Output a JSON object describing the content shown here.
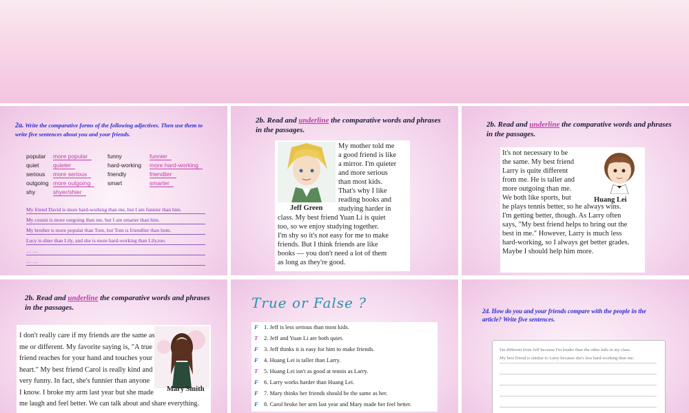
{
  "slide1": {
    "num": "2a.",
    "instruction": "Write the comparative forms of the following adjectives. Then use them to write five sentences about you and your friends.",
    "left_pairs": [
      {
        "adj": "popular",
        "ans": "more popular"
      },
      {
        "adj": "quiet",
        "ans": "quieter"
      },
      {
        "adj": "serious",
        "ans": "more serious"
      },
      {
        "adj": "outgoing",
        "ans": "more outgoing"
      },
      {
        "adj": "shy",
        "ans": "shyer/shier"
      }
    ],
    "right_pairs": [
      {
        "adj": "funny",
        "ans": "funnier"
      },
      {
        "adj": "hard-working",
        "ans": "more hard-working"
      },
      {
        "adj": "friendly",
        "ans": "friendlier"
      },
      {
        "adj": "smart",
        "ans": "smarter"
      }
    ],
    "sentences": [
      "My friend David is more hard-working than me, but I am funnier than him.",
      "My cousin is more outgoing than me, but I am smarter than him.",
      "My brother is more popular than Tom, but Tom is friendlier than hom.",
      "Lucy is shier than Lily, and she is more hard-working than Lily,too.",
      "… …",
      "… …"
    ]
  },
  "heading26": {
    "num": "2b.",
    "pre": "Read and",
    "ul": "underline",
    "post": "the comparative words and phrases",
    "line2": "in the passages."
  },
  "jeff": {
    "name": "Jeff Green",
    "right_lines": [
      "My mother told me",
      "a good friend is like",
      "a mirror. I'm quieter",
      "and more serious",
      "than most kids.",
      "That's why I like",
      "reading books and",
      "studying harder in"
    ],
    "lines": [
      "class. My best friend Yuan Li is quiet",
      "too, so we enjoy studying together.",
      "I'm shy so it's not easy for me to make",
      "friends. But I think friends are like",
      "books — you don't need a lot of them",
      "as long as they're good."
    ]
  },
  "huang": {
    "name": "Huang Lei",
    "left_lines": [
      "It's not necessary to be",
      "the same. My best friend",
      "Larry is quite different",
      "from me. He is taller and",
      "more outgoing than me.",
      "We both like sports, but"
    ],
    "lines": [
      "he plays tennis better, so he always wins.",
      "I'm getting better, though. As Larry often",
      "says, \"My best friend helps to bring out the",
      "best in me.\" However, Larry is much less",
      "hard-working, so I always get better grades.",
      "Maybe I should help him more."
    ]
  },
  "mary": {
    "name": "Mary Smith",
    "lines": [
      "I don't really care if my friends are the same as",
      "me or different. My favorite saying is, \"A true",
      "friend reaches for your hand and touches your",
      "heart.\" My best friend Carol is really kind and",
      "very funny. In fact, she's funnier than anyone",
      "I know. I broke my arm last year but she made",
      "me laugh and feel better. We can talk about and share everything."
    ]
  },
  "tf": {
    "title": "True or False ?",
    "items": [
      {
        "mark": "F",
        "text": "1. Jeff is less serious than most kids."
      },
      {
        "mark": "T",
        "text": "2. Jeff and Yuan Li are both quiet."
      },
      {
        "mark": "F",
        "text": "3. Jeff thinks it is easy for him to make friends."
      },
      {
        "mark": "F",
        "text": "4. Huang Lei is taller than Larry."
      },
      {
        "mark": "T",
        "text": "5. Huang Lei isn't as good at tennis as Larry."
      },
      {
        "mark": "F",
        "text": "6. Larry works harder than Huang Lei."
      },
      {
        "mark": "F",
        "text": "7. Mary thinks her friends should be the same as her."
      },
      {
        "mark": "F",
        "text": "8. Carol broke her arm last year and Mary made her feel better."
      }
    ]
  },
  "slide6": {
    "num": "2d.",
    "q1": "How do you  and your friends compare with the people in the",
    "q2": "article? Write five sentences.",
    "ex1": "I'm different from Jeff because I'm louder than the other kids in my class.",
    "ex2": "My best friend is similar to Larry because she's less hard-working than me."
  },
  "colors": {
    "accent": "#c03aa8",
    "heading": "#2a2ad0",
    "tf_title": "#2c8fb0"
  }
}
